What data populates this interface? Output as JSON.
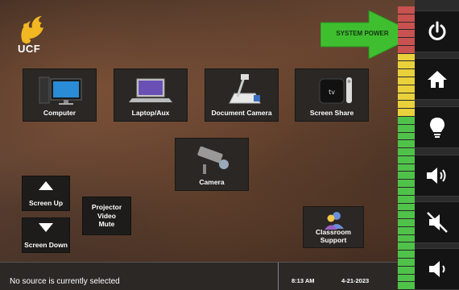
{
  "logo": {
    "text": "UCF",
    "colors": {
      "pegasus": "#f2b722",
      "text": "#ffffff"
    }
  },
  "sources": [
    {
      "id": "computer",
      "label": "Computer",
      "icon": "computer-icon"
    },
    {
      "id": "laptop",
      "label": "Laptop/Aux",
      "icon": "laptop-icon"
    },
    {
      "id": "doccam",
      "label": "Document Camera",
      "icon": "document-camera-icon"
    },
    {
      "id": "share",
      "label": "Screen Share",
      "icon": "apple-tv-icon"
    },
    {
      "id": "camera",
      "label": "Camera",
      "icon": "security-camera-icon"
    }
  ],
  "screen_controls": {
    "up_label": "Screen Up",
    "down_label": "Screen Down"
  },
  "projector_mute": {
    "label_line1": "Projector",
    "label_line2": "Video",
    "label_line3": "Mute"
  },
  "support": {
    "label_line1": "Classroom",
    "label_line2": "Support",
    "icon": "people-icon"
  },
  "system_power": {
    "label": "SYSTEM POWER",
    "arrow_color": "#3fbf2f"
  },
  "status": {
    "message": "No source is currently selected",
    "time": "8:13 AM",
    "date": "4-21-2023"
  },
  "right_panel": [
    {
      "id": "power",
      "icon": "power-icon"
    },
    {
      "id": "home",
      "icon": "home-icon"
    },
    {
      "id": "lightbulb",
      "icon": "lightbulb-icon"
    },
    {
      "id": "volume-up",
      "icon": "volume-up-icon"
    },
    {
      "id": "mute",
      "icon": "mute-icon"
    },
    {
      "id": "volume-down",
      "icon": "volume-down-icon"
    }
  ],
  "volume_meter": {
    "colors": {
      "red": "#c8524f",
      "yellow": "#e8d13a",
      "green": "#4fc24a"
    },
    "red_segments": 6,
    "yellow_segments": 8,
    "green_segments": 22
  }
}
